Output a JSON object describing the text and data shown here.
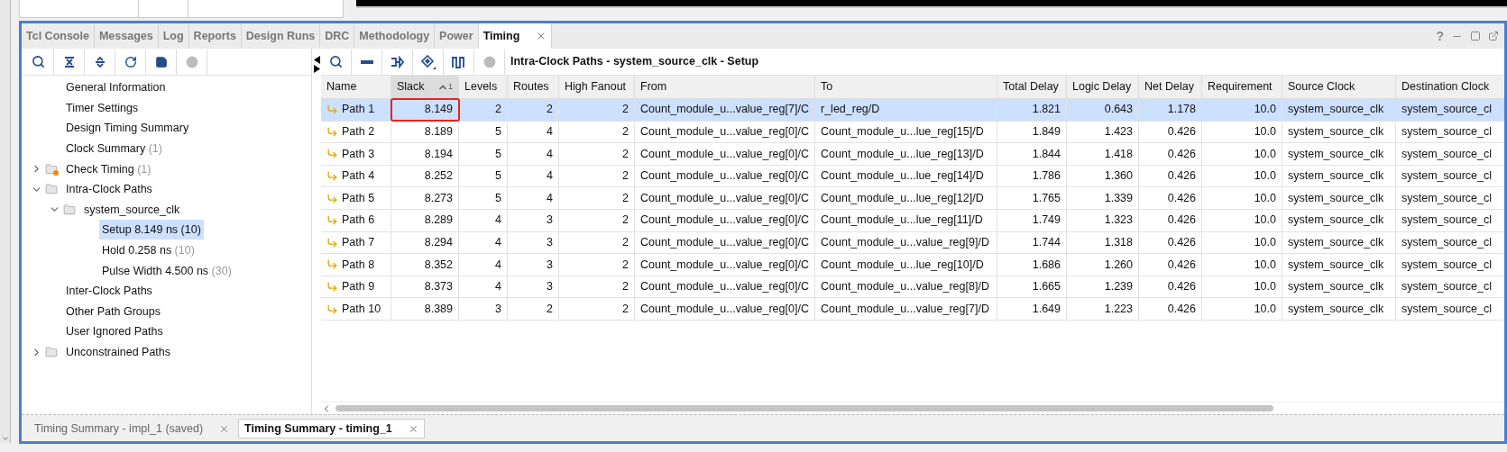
{
  "tabs": [
    {
      "label": "Tcl Console",
      "selected": false
    },
    {
      "label": "Messages",
      "selected": false
    },
    {
      "label": "Log",
      "selected": false
    },
    {
      "label": "Reports",
      "selected": false
    },
    {
      "label": "Design Runs",
      "selected": false
    },
    {
      "label": "DRC",
      "selected": false
    },
    {
      "label": "Methodology",
      "selected": false
    },
    {
      "label": "Power",
      "selected": false
    },
    {
      "label": "Timing",
      "selected": true
    }
  ],
  "window_controls": {
    "help": "?"
  },
  "tree": [
    {
      "label": "General Information",
      "selected": false
    },
    {
      "label": "Timer Settings",
      "selected": false
    },
    {
      "label": "Design Timing Summary",
      "selected": false
    },
    {
      "label": "Clock Summary",
      "count": "(1)",
      "selected": false
    },
    {
      "label": "Check Timing",
      "count": "(1)",
      "kind": "folder-warning",
      "expanded": false,
      "selected": false
    },
    {
      "label": "Intra-Clock Paths",
      "kind": "folder",
      "expanded": true,
      "selected": false,
      "children": [
        {
          "label": "system_source_clk",
          "kind": "folder",
          "expanded": true,
          "selected": false,
          "children": [
            {
              "label": "Setup 8.149 ns",
              "count": "(10)",
              "selected": true
            },
            {
              "label": "Hold 0.258 ns",
              "count": "(10)",
              "selected": false
            },
            {
              "label": "Pulse Width 4.500 ns",
              "count": "(30)",
              "selected": false
            }
          ]
        }
      ]
    },
    {
      "label": "Inter-Clock Paths",
      "selected": false
    },
    {
      "label": "Other Path Groups",
      "selected": false
    },
    {
      "label": "User Ignored Paths",
      "selected": false
    },
    {
      "label": "Unconstrained Paths",
      "kind": "folder",
      "expanded": false,
      "selected": false
    }
  ],
  "panel_title": "Intra-Clock Paths - system_source_clk - Setup",
  "table": {
    "columns": [
      {
        "label": "Name",
        "kind": "name"
      },
      {
        "label": "Slack",
        "kind": "number",
        "sort_ascending": true,
        "sort_rank": "1"
      },
      {
        "label": "Levels",
        "kind": "number"
      },
      {
        "label": "Routes",
        "kind": "number"
      },
      {
        "label": "High Fanout",
        "kind": "number"
      },
      {
        "label": "From",
        "kind": "text"
      },
      {
        "label": "To",
        "kind": "text"
      },
      {
        "label": "Total Delay",
        "kind": "number"
      },
      {
        "label": "Logic Delay",
        "kind": "number"
      },
      {
        "label": "Net Delay",
        "kind": "number"
      },
      {
        "label": "Requirement",
        "kind": "number"
      },
      {
        "label": "Source Clock",
        "kind": "text"
      },
      {
        "label": "Destination Clock",
        "kind": "text"
      }
    ],
    "rows": [
      {
        "selected": true,
        "highlighted": true,
        "cells": [
          "Path 1",
          "8.149",
          "2",
          "2",
          "2",
          "Count_module_u...value_reg[7]/C",
          "r_led_reg/D",
          "1.821",
          "0.643",
          "1.178",
          "10.0",
          "system_source_clk",
          "system_source_cl"
        ]
      },
      {
        "selected": false,
        "highlighted": false,
        "cells": [
          "Path 2",
          "8.189",
          "5",
          "4",
          "2",
          "Count_module_u...value_reg[0]/C",
          "Count_module_u...lue_reg[15]/D",
          "1.849",
          "1.423",
          "0.426",
          "10.0",
          "system_source_clk",
          "system_source_cl"
        ]
      },
      {
        "selected": false,
        "highlighted": false,
        "cells": [
          "Path 3",
          "8.194",
          "5",
          "4",
          "2",
          "Count_module_u...value_reg[0]/C",
          "Count_module_u...lue_reg[13]/D",
          "1.844",
          "1.418",
          "0.426",
          "10.0",
          "system_source_clk",
          "system_source_cl"
        ]
      },
      {
        "selected": false,
        "highlighted": false,
        "cells": [
          "Path 4",
          "8.252",
          "5",
          "4",
          "2",
          "Count_module_u...value_reg[0]/C",
          "Count_module_u...lue_reg[14]/D",
          "1.786",
          "1.360",
          "0.426",
          "10.0",
          "system_source_clk",
          "system_source_cl"
        ]
      },
      {
        "selected": false,
        "highlighted": false,
        "cells": [
          "Path 5",
          "8.273",
          "5",
          "4",
          "2",
          "Count_module_u...value_reg[0]/C",
          "Count_module_u...lue_reg[12]/D",
          "1.765",
          "1.339",
          "0.426",
          "10.0",
          "system_source_clk",
          "system_source_cl"
        ]
      },
      {
        "selected": false,
        "highlighted": false,
        "cells": [
          "Path 6",
          "8.289",
          "4",
          "3",
          "2",
          "Count_module_u...value_reg[0]/C",
          "Count_module_u...lue_reg[11]/D",
          "1.749",
          "1.323",
          "0.426",
          "10.0",
          "system_source_clk",
          "system_source_cl"
        ]
      },
      {
        "selected": false,
        "highlighted": false,
        "cells": [
          "Path 7",
          "8.294",
          "4",
          "3",
          "2",
          "Count_module_u...value_reg[0]/C",
          "Count_module_u...value_reg[9]/D",
          "1.744",
          "1.318",
          "0.426",
          "10.0",
          "system_source_clk",
          "system_source_cl"
        ]
      },
      {
        "selected": false,
        "highlighted": false,
        "cells": [
          "Path 8",
          "8.352",
          "4",
          "3",
          "2",
          "Count_module_u...value_reg[0]/C",
          "Count_module_u...lue_reg[10]/D",
          "1.686",
          "1.260",
          "0.426",
          "10.0",
          "system_source_clk",
          "system_source_cl"
        ]
      },
      {
        "selected": false,
        "highlighted": false,
        "cells": [
          "Path 9",
          "8.373",
          "4",
          "3",
          "2",
          "Count_module_u...value_reg[0]/C",
          "Count_module_u...value_reg[8]/D",
          "1.665",
          "1.239",
          "0.426",
          "10.0",
          "system_source_clk",
          "system_source_cl"
        ]
      },
      {
        "selected": false,
        "highlighted": false,
        "cells": [
          "Path 10",
          "8.389",
          "3",
          "2",
          "2",
          "Count_module_u...value_reg[0]/C",
          "Count_module_u...value_reg[7]/D",
          "1.649",
          "1.223",
          "0.426",
          "10.0",
          "system_source_clk",
          "system_source_cl"
        ]
      }
    ]
  },
  "bottom_tabs": [
    {
      "label": "Timing Summary - impl_1 (saved)",
      "selected": false
    },
    {
      "label": "Timing Summary - timing_1",
      "selected": true
    }
  ]
}
